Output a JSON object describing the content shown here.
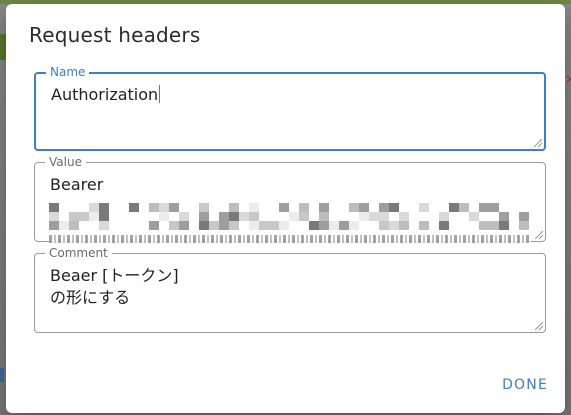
{
  "dialog": {
    "title": "Request headers",
    "fields": {
      "name": {
        "label": "Name",
        "value": "Authorization"
      },
      "value": {
        "label": "Value",
        "value": "Bearer"
      },
      "comment": {
        "label": "Comment",
        "value": "Beaer [トークン]\nの形にする"
      }
    },
    "done_label": "DONE"
  },
  "colors": {
    "accent": "#3f7fbf",
    "border": "#9a9a9a",
    "text": "#222222"
  }
}
